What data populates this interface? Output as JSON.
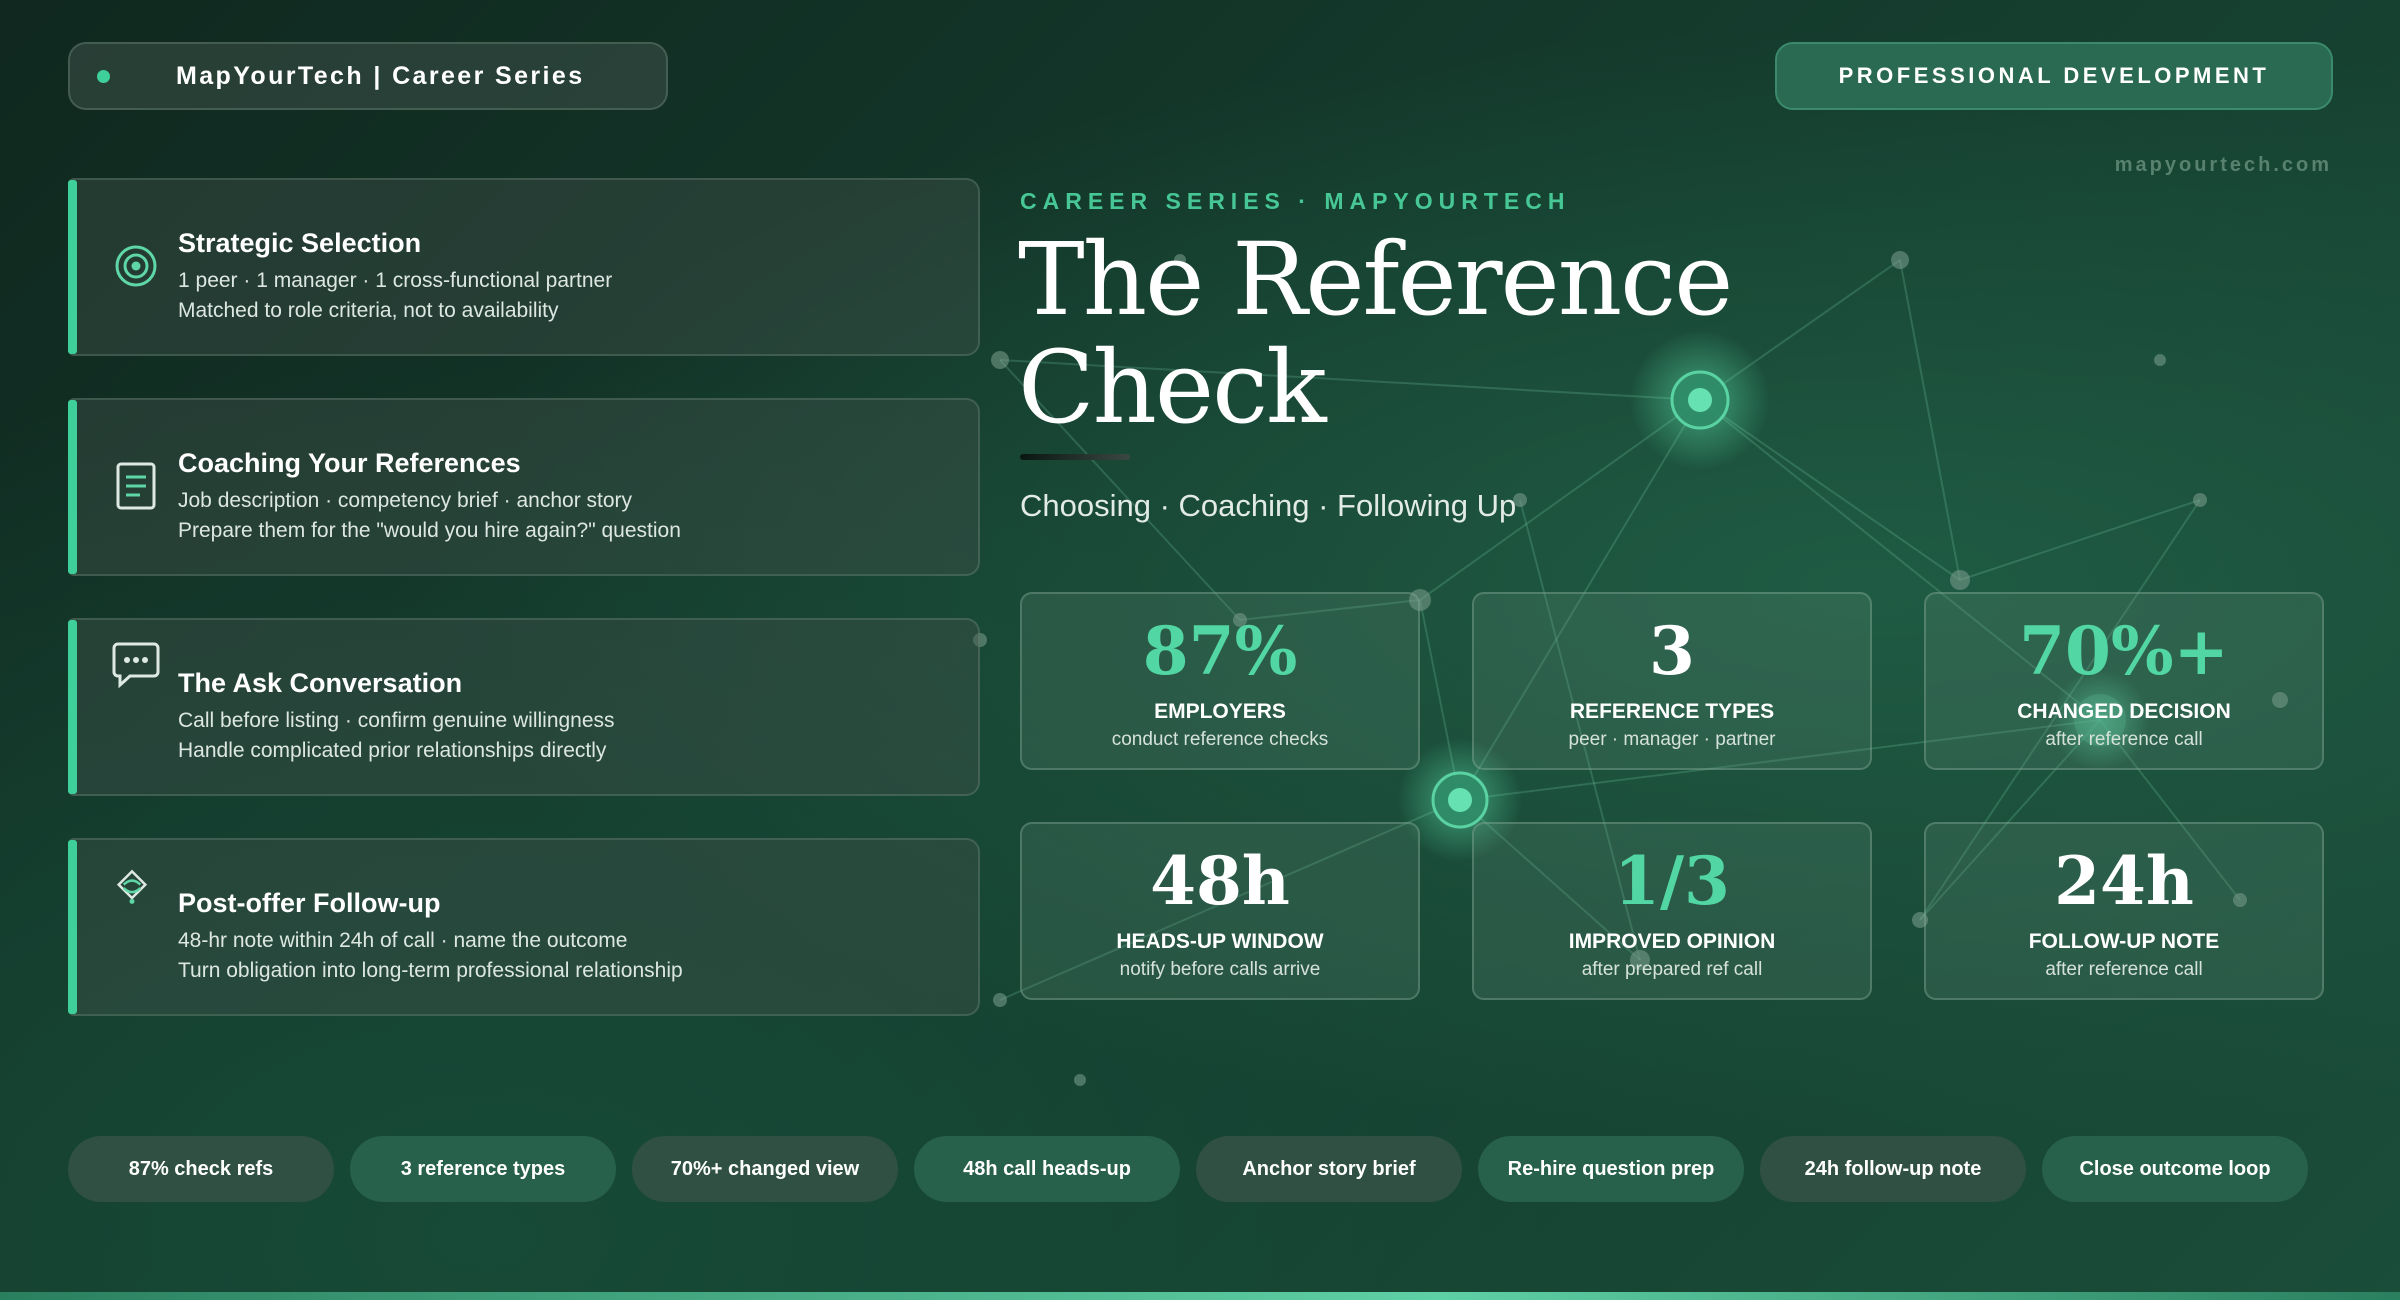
{
  "header": {
    "brand": "MapYourTech | Career Series",
    "badge": "PROFESSIONAL DEVELOPMENT",
    "site": "mapyourtech.com"
  },
  "features": [
    {
      "icon": "target-icon",
      "title": "Strategic Selection",
      "line1": "1 peer · 1 manager · 1 cross-functional partner",
      "line2": "Matched to role criteria, not to availability"
    },
    {
      "icon": "document-icon",
      "title": "Coaching Your References",
      "line1": "Job description · competency brief · anchor story",
      "line2": "Prepare them for the \"would you hire again?\" question"
    },
    {
      "icon": "chat-bubble-icon",
      "title": "The Ask Conversation",
      "line1": "Call before listing · confirm genuine willingness",
      "line2": "Handle complicated prior relationships directly"
    },
    {
      "icon": "handshake-icon",
      "title": "Post-offer Follow-up",
      "line1": "48-hr note within 24h of call · name the outcome",
      "line2": "Turn obligation into long-term professional relationship"
    }
  ],
  "hero": {
    "kicker": "CAREER SERIES · MAPYOURTECH",
    "title": "The Reference Check",
    "subtitle": "Choosing · Coaching · Following Up"
  },
  "stats": [
    {
      "value": "87%",
      "label": "EMPLOYERS",
      "sub": "conduct reference checks"
    },
    {
      "value": "3",
      "label": "REFERENCE TYPES",
      "sub": "peer · manager · partner"
    },
    {
      "value": "70%+",
      "label": "CHANGED DECISION",
      "sub": "after reference call"
    },
    {
      "value": "48h",
      "label": "HEADS-UP WINDOW",
      "sub": "notify before calls arrive"
    },
    {
      "value": "1/3",
      "label": "IMPROVED OPINION",
      "sub": "after prepared ref call"
    },
    {
      "value": "24h",
      "label": "FOLLOW-UP NOTE",
      "sub": "after reference call"
    }
  ],
  "chips": [
    "87% check refs",
    "3 reference types",
    "70%+ changed view",
    "48h call heads-up",
    "Anchor story brief",
    "Re-hire question prep",
    "24h follow-up note",
    "Close outcome loop"
  ],
  "colors": {
    "accent": "#3ecf9a",
    "accent_text": "#52d6a3",
    "background": "#143a2c"
  }
}
